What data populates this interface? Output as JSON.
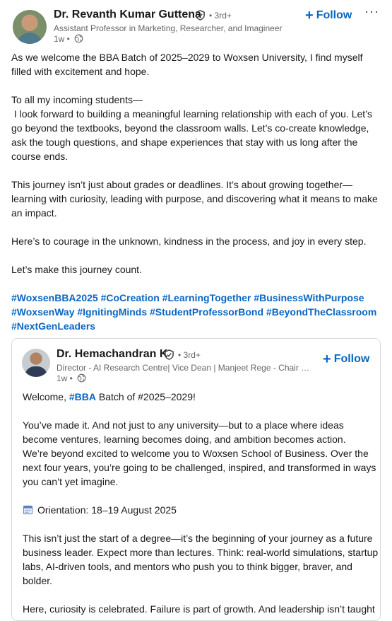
{
  "author": {
    "name": "Dr. Revanth Kumar Guttena",
    "degree": "• 3rd+",
    "headline": "Assistant Professor in Marketing, Researcher, and Imagineer",
    "time": "1w •",
    "follow_label": "Follow",
    "more_label": "···"
  },
  "post": {
    "p1": "As we welcome the BBA Batch of 2025–2029 to Woxsen University, I find myself filled with excitement and hope.",
    "p2a": "To all my incoming students—",
    "p2b": " I look forward to building a meaningful learning relationship with each of you. Let’s go beyond the textbooks, beyond the classroom walls. Let’s co-create knowledge, ask the tough questions, and shape experiences that stay with us long after the course ends.",
    "p3": "This journey isn’t just about grades or deadlines. It’s about growing together—learning with curiosity, leading with purpose, and discovering what it means to make an impact.",
    "p4": "Here’s to courage in the unknown, kindness in the process, and joy in every step.",
    "p5": "Let’s make this journey count.",
    "hashtags": "#WoxsenBBA2025 #CoCreation #LearningTogether #BusinessWithPurpose #WoxsenWay #IgnitingMinds #StudentProfessorBond #BeyondTheClassroom #NextGenLeaders"
  },
  "shared": {
    "name": "Dr. Hemachandran K",
    "degree": "• 3rd+",
    "headline": "Director - AI Research Centre| Vice Dean | Manjeet Rege - Chair Pro...",
    "time": "1w •",
    "follow_label": "Follow",
    "welcome_prefix": "Welcome, ",
    "welcome_link": "#BBA",
    "welcome_suffix": " Batch of #2025–2029!",
    "p2": "You’ve made it. And not just to any university—but to a place where ideas become ventures, learning becomes doing, and ambition becomes action.",
    "p3": "We’re beyond excited to welcome you to Woxsen School of Business. Over the next four years, you’re going to be challenged, inspired, and transformed in ways you can’t yet imagine.",
    "orientation": "Orientation: 18–19 August 2025",
    "p5": "This isn’t just the start of a degree—it’s the beginning of your journey as a future business leader. Expect more than lectures. Think: real-world simulations, startup labs, AI-driven tools, and mentors who push you to think bigger, braver, and bolder.",
    "p6": "Here, curiosity is celebrated. Failure is part of growth. And leadership isn’t taught—"
  },
  "colors": {
    "accent": "#0a66c2",
    "muted": "#666666",
    "text": "#191919"
  },
  "icons": [
    "verified-shield-icon",
    "globe-icon",
    "plus-icon",
    "more-icon",
    "calendar-icon"
  ]
}
